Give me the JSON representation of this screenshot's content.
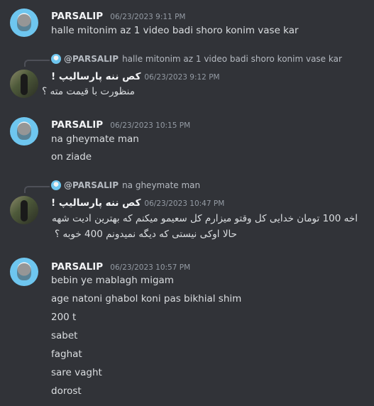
{
  "messages": [
    {
      "user": "PARSALIP",
      "time": "06/23/2023 9:11 PM",
      "lines": [
        "halle mitonim az 1 video badi shoro konim vase kar"
      ]
    },
    {
      "reply": {
        "name": "@PARSALIP",
        "text": "halle mitonim az 1 video badi shoro konim vase kar"
      },
      "user": "کص ننه پارسالیپ !",
      "time": "06/23/2023 9:12 PM",
      "lines": [
        "منظورت با قیمت مته ؟"
      ]
    },
    {
      "user": "PARSALIP",
      "time": "06/23/2023 10:15 PM",
      "lines": [
        "na gheymate man",
        "on ziade"
      ]
    },
    {
      "reply": {
        "name": "@PARSALIP",
        "text": "na gheymate man"
      },
      "user": "کص ننه پارسالیپ !",
      "time": "06/23/2023 10:47 PM",
      "lines": [
        "اخه  100 تومان خدایی کل وقتو میزارم کل سعیمو میکنم که بهترین ادیت شهه",
        "حالا اوکی نیستی که دیگه نمیدونم 400 خوبه ؟"
      ]
    },
    {
      "user": "PARSALIP",
      "time": "06/23/2023 10:57 PM",
      "lines": [
        "bebin ye mablagh migam",
        "age natoni ghabol koni pas bikhial shim",
        "200 t",
        "sabet",
        "faghat",
        "sare vaght",
        "dorost"
      ]
    }
  ]
}
